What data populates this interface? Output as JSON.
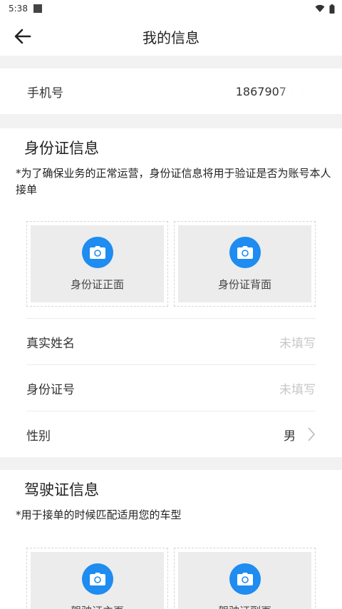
{
  "status": {
    "time": "5:38"
  },
  "appbar": {
    "title": "我的信息",
    "back_icon": "arrow-left-icon"
  },
  "phone": {
    "label": "手机号",
    "value": "1867907"
  },
  "id_section": {
    "title": "身份证信息",
    "note": "*为了确保业务的正常运营，身份证信息将用于验证是否为账号本人接单",
    "cards": [
      {
        "label": "身份证正面",
        "icon": "camera-icon"
      },
      {
        "label": "身份证背面",
        "icon": "camera-icon"
      }
    ],
    "rows": [
      {
        "label": "真实姓名",
        "value": "未填写"
      },
      {
        "label": "身份证号",
        "value": "未填写"
      },
      {
        "label": "性别",
        "value": "男"
      }
    ]
  },
  "license_section": {
    "title": "驾驶证信息",
    "note": "*用于接单的时候匹配适用您的车型",
    "cards": [
      {
        "label": "驾驶证主页",
        "icon": "camera-icon"
      },
      {
        "label": "驾驶证副页",
        "icon": "camera-icon"
      }
    ]
  },
  "colors": {
    "accent": "#1e8cf0",
    "placeholder": "#c7c7c7",
    "background": "#f2f2f2"
  }
}
